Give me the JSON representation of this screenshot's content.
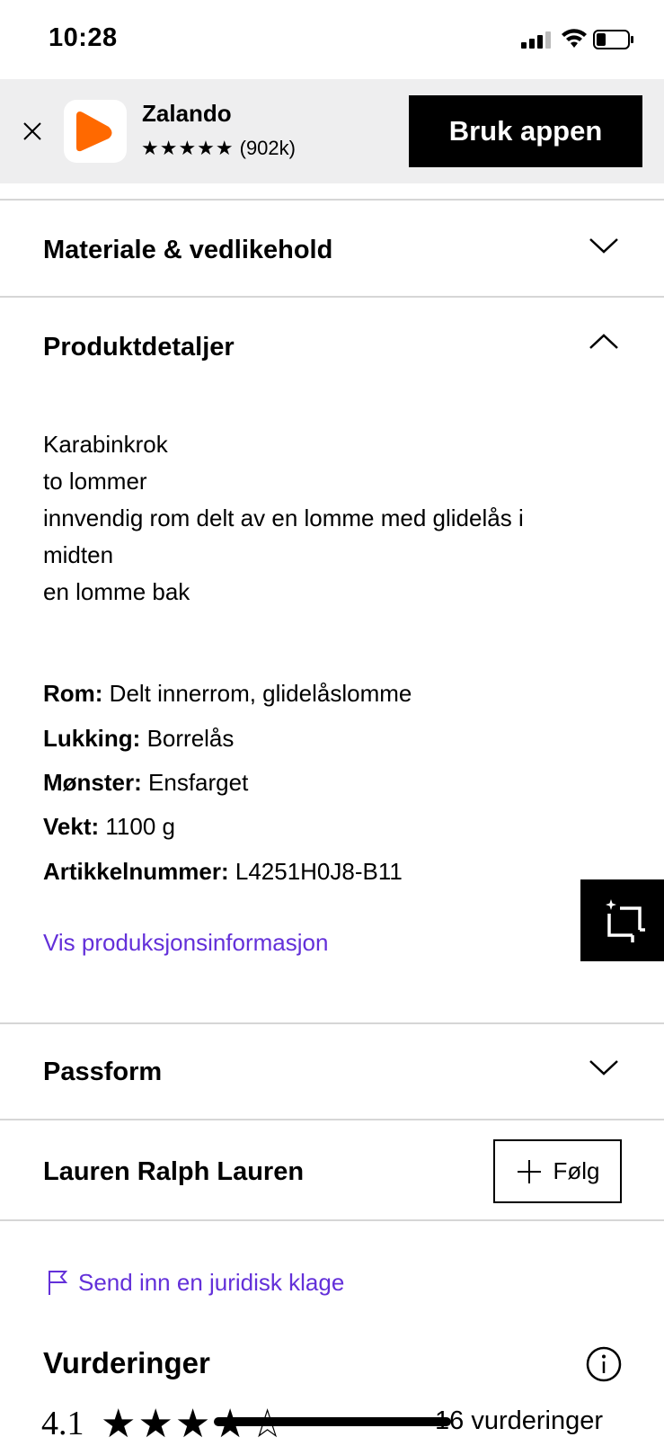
{
  "status_bar": {
    "time": "10:28"
  },
  "app_banner": {
    "app_name": "Zalando",
    "stars": "★★★★★",
    "rating_count": "(902k)",
    "cta_label": "Bruk appen",
    "brand_color": "#ff6900"
  },
  "sections": {
    "material": {
      "title": "Materiale & vedlikehold"
    },
    "details": {
      "title": "Produktdetaljer",
      "description_lines": [
        "Karabinkrok",
        "to lommer",
        "innvendig rom delt av en lomme med glidelås i",
        "midten",
        "en lomme bak"
      ],
      "attributes": [
        {
          "label": "Rom:",
          "value": "Delt innerrom, glidelåslomme"
        },
        {
          "label": "Lukking:",
          "value": "Borrelås"
        },
        {
          "label": "Mønster:",
          "value": "Ensfarget"
        },
        {
          "label": "Vekt:",
          "value": "1100 g"
        },
        {
          "label": "Artikkelnummer:",
          "value": "L4251H0J8-B11"
        }
      ],
      "production_link": "Vis produksjonsinformasjon"
    },
    "fit": {
      "title": "Passform"
    },
    "brand": {
      "name": "Lauren Ralph Lauren",
      "follow_label": "Følg"
    },
    "legal": {
      "complaint_link": "Send inn en juridisk klage"
    },
    "reviews": {
      "title": "Vurderinger",
      "average": "4.1",
      "count_text": "16 vurderinger",
      "star_rating": 4.1
    }
  },
  "colors": {
    "accent_link": "#6330d9",
    "divider": "#d6d6d6",
    "banner_bg": "#eeeeef"
  }
}
